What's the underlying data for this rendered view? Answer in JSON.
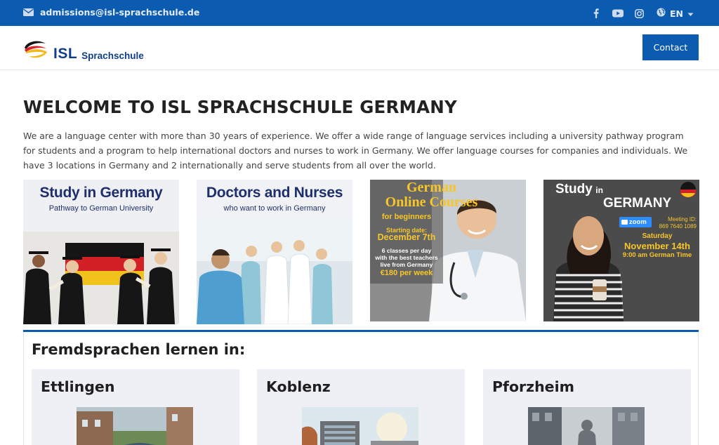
{
  "topbar": {
    "email": "admissions@isl-sprachschule.de",
    "language": "EN",
    "social_icons": [
      "facebook-icon",
      "youtube-icon",
      "instagram-icon"
    ]
  },
  "header": {
    "logo_mark": "ISL",
    "logo_text": "Sprachschule",
    "contact_label": "Contact"
  },
  "main": {
    "title": "WELCOME TO ISL SPRACHSCHULE GERMANY",
    "intro": "We are a language center with more than 30 years of experience. We offer a wide range of language services including a university pathway program for students and a program to help international doctors and nurses to work in Germany. We offer language courses for companies and individuals. We have 3 locations in Germany and 2 internationally and serve students from all over the world."
  },
  "tiles": [
    {
      "heading": "Study in Germany",
      "subheading": "Pathway to German University"
    },
    {
      "heading": "Doctors and Nurses",
      "subheading": "who want to work in Germany"
    },
    {
      "heading_line1": "German",
      "heading_line2": "Online Courses",
      "for_label": "for beginners",
      "start_label": "Starting date:",
      "start_date": "December 7th",
      "desc_line1": "6 classes per day",
      "desc_line2": "with the best teachers",
      "desc_line3": "live from Germany",
      "price": "€180 per week"
    },
    {
      "heading_study": "Study",
      "heading_in": "in",
      "heading_country": "GERMANY",
      "zoom_label": "zoom",
      "meeting_label": "Meeting ID:",
      "meeting_id": "869 7640 1089",
      "day": "Saturday",
      "date": "November 14th",
      "time": "9:00 am German Time"
    }
  ],
  "section": {
    "title": "Fremdsprachen lernen in:",
    "locations": [
      "Ettlingen",
      "Koblenz",
      "Pforzheim"
    ]
  },
  "colors": {
    "brand_blue": "#0b5cb0",
    "logo_navy": "#123d8a",
    "tile_gold": "#f7c629"
  }
}
